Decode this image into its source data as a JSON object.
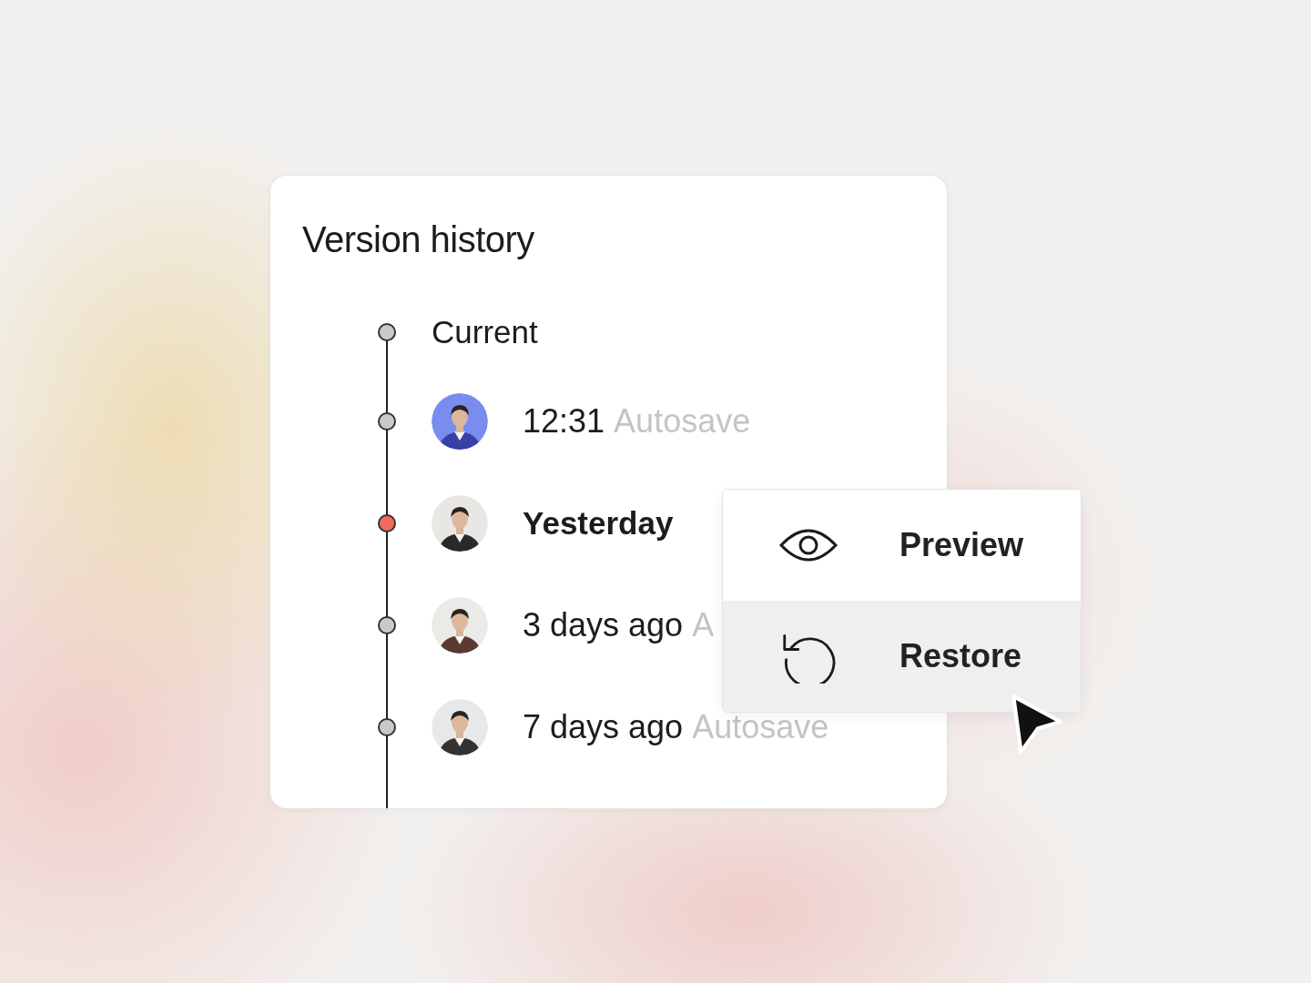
{
  "panel": {
    "title": "Version history"
  },
  "versions": [
    {
      "kind": "current",
      "label": "Current",
      "selected": false
    },
    {
      "kind": "avatar",
      "label": "12:31",
      "note": "Autosave",
      "selected": false
    },
    {
      "kind": "avatar",
      "label": "Yesterday",
      "selected": true
    },
    {
      "kind": "avatar",
      "label": "3 days ago",
      "note": "A",
      "selected": false
    },
    {
      "kind": "avatar",
      "label": "7 days ago",
      "note": "Autosave",
      "selected": false
    }
  ],
  "menu": {
    "items": [
      {
        "kind": "preview",
        "label": "Preview",
        "selected": false
      },
      {
        "kind": "restore",
        "label": "Restore",
        "selected": true
      }
    ]
  }
}
